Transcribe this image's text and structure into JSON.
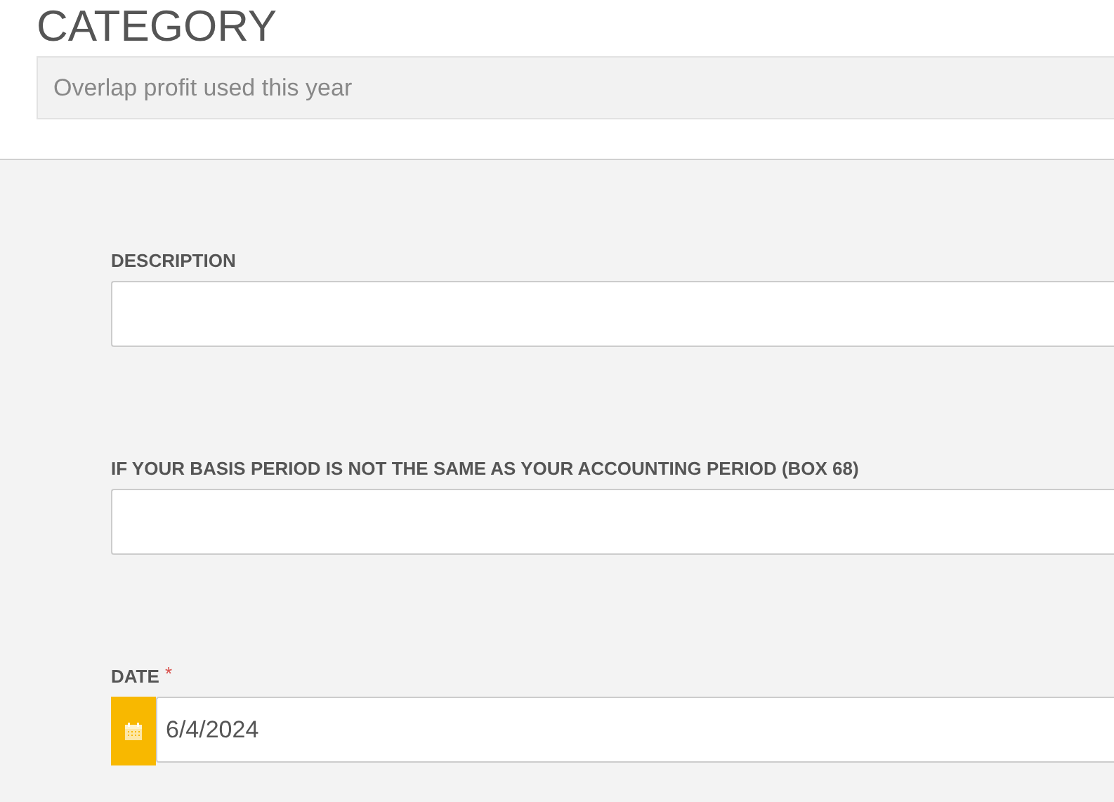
{
  "category": {
    "heading": "CATEGORY",
    "value": "Overlap profit used this year"
  },
  "fields": [
    {
      "kind": "text",
      "label": "DESCRIPTION"
    },
    {
      "kind": "text",
      "label": "IF YOUR BASIS PERIOD IS NOT THE SAME AS YOUR ACCOUNTING PERIOD (BOX 68)"
    },
    {
      "kind": "date",
      "label": "DATE",
      "required_mark": "*",
      "value": "6/4/2024"
    }
  ]
}
